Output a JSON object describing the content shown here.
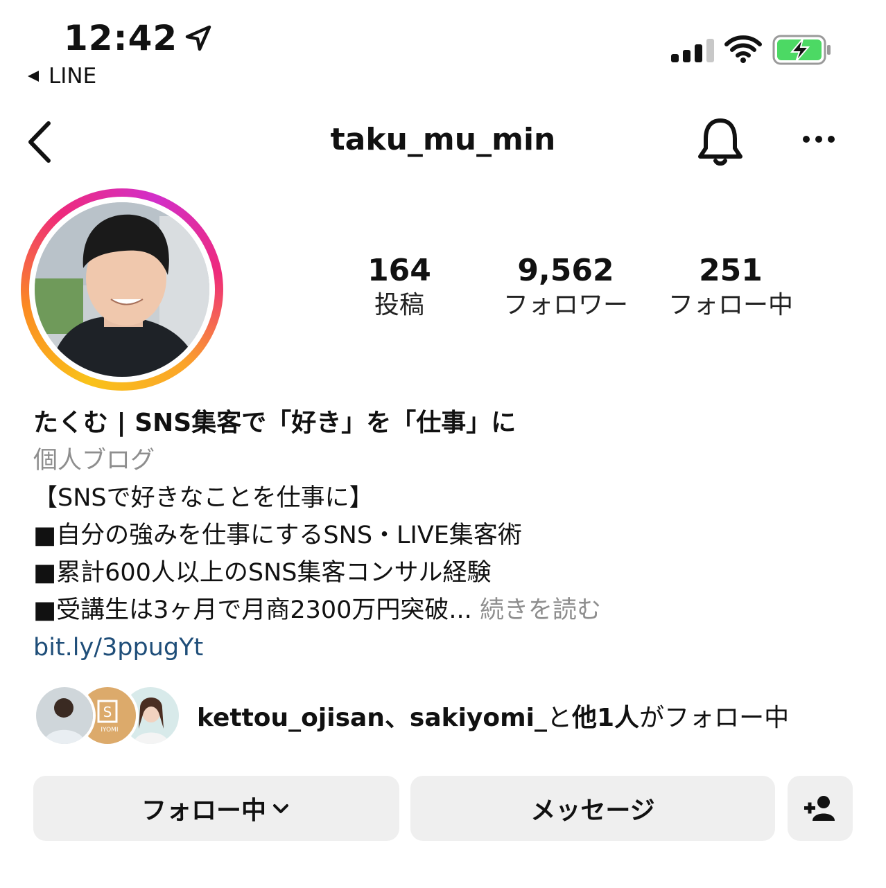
{
  "status_bar": {
    "time": "12:42",
    "back_app": "LINE"
  },
  "header": {
    "username": "taku_mu_min"
  },
  "stats": [
    {
      "value": "164",
      "label": "投稿"
    },
    {
      "value": "9,562",
      "label": "フォロワー"
    },
    {
      "value": "251",
      "label": "フォロー中"
    }
  ],
  "bio": {
    "name": "たくむ | SNS集客で「好き」を「仕事」に",
    "category": "個人ブログ",
    "lines": [
      "【SNSで好きなことを仕事に】",
      "■自分の強みを仕事にするSNS・LIVE集客術",
      "■累計600人以上のSNS集客コンサル経験",
      "■受講生は3ヶ月で月商2300万円突破..."
    ],
    "more": "続きを読む",
    "link": "bit.ly/3ppugYt"
  },
  "followed_by": {
    "users": "kettou_ojisan、sakiyomi_",
    "connector": "と",
    "others": "他1人",
    "suffix": "がフォロー中",
    "mini_logo_text": "IYOMI"
  },
  "buttons": {
    "follow": "フォロー中",
    "message": "メッセージ"
  },
  "colors": {
    "button_bg": "#efefef",
    "link": "#1f4e79",
    "muted": "#8e8e8e",
    "battery_charge": "#4cd964"
  }
}
